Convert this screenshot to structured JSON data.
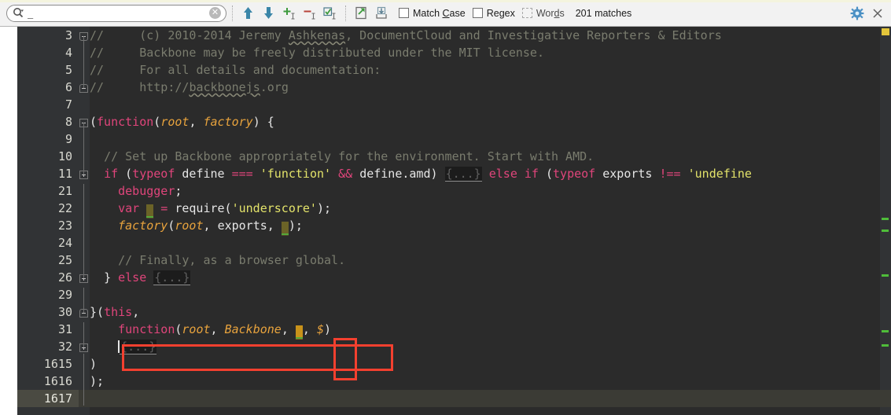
{
  "toolbar": {
    "search": {
      "value": "_",
      "placeholder": "",
      "icon": "search-icon",
      "dropdown_icon": "chevron-down-icon",
      "clear_icon": "clear-icon",
      "clear_glyph": "✕"
    },
    "buttons": [
      {
        "name": "find-previous-button",
        "icon": "arrow-up-icon",
        "glyph": "⬆"
      },
      {
        "name": "find-next-button",
        "icon": "arrow-down-icon",
        "glyph": "⬇"
      },
      {
        "name": "add-selection-button",
        "icon": "plus-cursor-icon",
        "glyph": "+"
      },
      {
        "name": "remove-selection-button",
        "icon": "minus-cursor-icon",
        "glyph": "−"
      },
      {
        "name": "select-all-button",
        "icon": "select-all-cursor-icon",
        "glyph": "☑"
      },
      {
        "name": "open-in-editor-button",
        "icon": "export-arrow-icon",
        "glyph": "↗"
      },
      {
        "name": "find-in-path-button",
        "icon": "import-arrow-icon",
        "glyph": "↓"
      }
    ],
    "checkboxes": [
      {
        "name": "match-case-checkbox",
        "label_pre": "Match ",
        "label_mnemonic": "C",
        "label_post": "ase",
        "checked": false,
        "disabled": false
      },
      {
        "name": "regex-checkbox",
        "label_pre": "Re",
        "label_mnemonic": "g",
        "label_post": "ex",
        "checked": false,
        "disabled": false
      },
      {
        "name": "words-checkbox",
        "label_pre": "Wor",
        "label_mnemonic": "d",
        "label_post": "s",
        "checked": false,
        "disabled": true
      }
    ],
    "status": "201 matches",
    "right_buttons": [
      {
        "name": "settings-button",
        "icon": "gear-icon",
        "glyph": "⚙"
      },
      {
        "name": "close-button",
        "icon": "close-icon",
        "glyph": "✕"
      }
    ]
  },
  "colors": {
    "editor_background": "#2b2b2b",
    "gutter_background": "#313335",
    "toolbar_background": "#f2f2f2",
    "comment": "#7a7c6e",
    "keyword": "#e0457b",
    "string": "#e3e36a",
    "function": "#e8a33d",
    "plain": "#e6e6e6",
    "match_highlight": "#6b6327",
    "current_match_highlight": "#c8921a",
    "annotation_red": "#f4402f",
    "marker_green": "#4fbd3a",
    "marker_yellow": "#e3c53b"
  },
  "editor": {
    "lines": [
      {
        "num": "3",
        "fold": "cap-top",
        "current": false
      },
      {
        "num": "4",
        "fold": "line",
        "current": false
      },
      {
        "num": "5",
        "fold": "line",
        "current": false
      },
      {
        "num": "6",
        "fold": "cap-bot",
        "current": false
      },
      {
        "num": "7",
        "fold": "none",
        "current": false
      },
      {
        "num": "8",
        "fold": "minus",
        "current": false
      },
      {
        "num": "9",
        "fold": "line",
        "current": false
      },
      {
        "num": "10",
        "fold": "line",
        "current": false
      },
      {
        "num": "11",
        "fold": "plus",
        "current": false
      },
      {
        "num": "21",
        "fold": "line",
        "current": false
      },
      {
        "num": "22",
        "fold": "line",
        "current": false
      },
      {
        "num": "23",
        "fold": "line",
        "current": false
      },
      {
        "num": "24",
        "fold": "line",
        "current": false
      },
      {
        "num": "25",
        "fold": "line",
        "current": false
      },
      {
        "num": "26",
        "fold": "plus",
        "current": false
      },
      {
        "num": "29",
        "fold": "line",
        "current": false
      },
      {
        "num": "30",
        "fold": "cap-bot",
        "current": false
      },
      {
        "num": "31",
        "fold": "none",
        "current": false
      },
      {
        "num": "32",
        "fold": "plus",
        "current": false
      },
      {
        "num": "1615",
        "fold": "none",
        "current": false
      },
      {
        "num": "1616",
        "fold": "none",
        "current": false
      },
      {
        "num": "1617",
        "fold": "none",
        "current": true
      }
    ],
    "code_text": {
      "l3": "//     (c) 2010-2014 Jeremy Ashkenas, DocumentCloud and Investigative Reporters & Editors",
      "l4": "//     Backbone may be freely distributed under the MIT license.",
      "l5": "//     For all details and documentation:",
      "l6": "//     http://backbonejs.org",
      "l8": "(function(root, factory) {",
      "l10": "  // Set up Backbone appropriately for the environment. Start with AMD.",
      "l11": "  if (typeof define === 'function' && define.amd) {...} else if (typeof exports !== 'undefine",
      "l21": "    debugger;",
      "l22": "    var _ = require('underscore');",
      "l23": "    factory(root, exports, _);",
      "l25": "    // Finally, as a browser global.",
      "l26": "  } else {...}",
      "l30": "}(this,",
      "l31": "  function(root, Backbone, _, $)",
      "l32": "   {...}",
      "l1615": ")",
      "l1616": ");"
    },
    "fold_placeholder": "{...}"
  }
}
